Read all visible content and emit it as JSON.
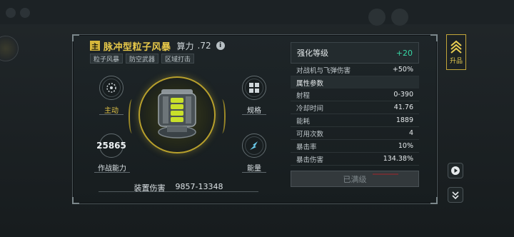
{
  "weapon": {
    "main_badge": "主",
    "name": "脉冲型粒子风暴",
    "power_label": "算力",
    "power_value": ".72",
    "tags": [
      "粒子风暴",
      "防空武器",
      "区域打击"
    ]
  },
  "slots": {
    "main_label": "主动",
    "combat_value": "25865",
    "combat_label": "作战能力",
    "spec_label": "规格",
    "energy_label": "能量"
  },
  "damage": {
    "label": "装置伤害",
    "value": "9857-13348"
  },
  "stats": {
    "strengthen_label": "强化等级",
    "strengthen_value": "+20",
    "bonus": {
      "label": "对战机与飞弹伤害",
      "value": "+50%"
    },
    "section_title": "属性参数",
    "rows": [
      {
        "label": "射程",
        "value": "0-390"
      },
      {
        "label": "冷却时间",
        "value": "41.76"
      },
      {
        "label": "能耗",
        "value": "1889"
      },
      {
        "label": "可用次数",
        "value": "4"
      },
      {
        "label": "暴击率",
        "value": "10%"
      },
      {
        "label": "暴击伤害",
        "value": "134.38%"
      }
    ],
    "max_label": "已满级"
  },
  "side": {
    "upgrade_label": "升品"
  },
  "colors": {
    "gold": "#e8c94a",
    "teal": "#37d8a6",
    "panel_border": "#4a5357"
  }
}
